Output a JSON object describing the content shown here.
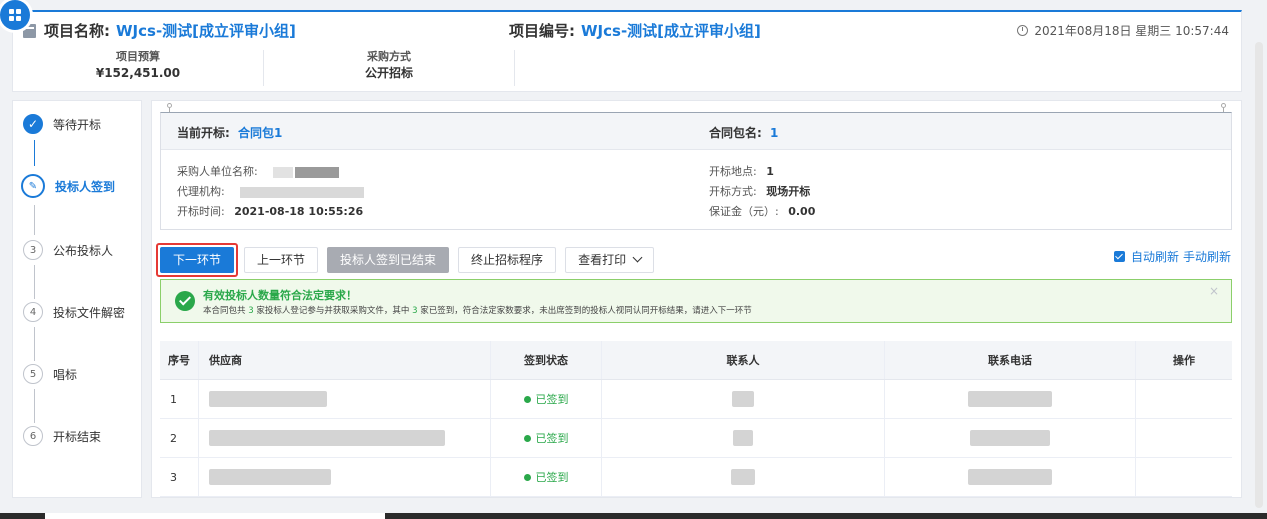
{
  "header": {
    "project_name_label": "项目名称:",
    "project_name": "WJcs-测试[成立评审小组]",
    "project_no_label": "项目编号:",
    "project_no": "WJcs-测试[成立评审小组]",
    "datetime": "2021年08月18日 星期三 10:57:44",
    "budget_label": "项目预算",
    "budget": "¥152,451.00",
    "method_label": "采购方式",
    "method": "公开招标"
  },
  "steps": [
    {
      "index": "✓",
      "label": "等待开标",
      "state": "done"
    },
    {
      "index": "✎",
      "label": "投标人签到",
      "state": "active"
    },
    {
      "index": "3",
      "label": "公布投标人",
      "state": "pending"
    },
    {
      "index": "4",
      "label": "投标文件解密",
      "state": "pending"
    },
    {
      "index": "5",
      "label": "唱标",
      "state": "pending"
    },
    {
      "index": "6",
      "label": "开标结束",
      "state": "pending"
    }
  ],
  "opening": {
    "current_label": "当前开标:",
    "current_value": "合同包1",
    "package_label": "合同包名:",
    "package_value": "1",
    "purchaser_label": "采购人单位名称:",
    "agency_label": "代理机构:",
    "time_label": "开标时间:",
    "time_value": "2021-08-18 10:55:26",
    "place_label": "开标地点:",
    "place_value": "1",
    "mode_label": "开标方式:",
    "mode_value": "现场开标",
    "deposit_label": "保证金（元）:",
    "deposit_value": "0.00"
  },
  "buttons": {
    "next": "下一环节",
    "prev": "上一环节",
    "signin_ended": "投标人签到已结束",
    "terminate": "终止招标程序",
    "print": "查看打印"
  },
  "refresh": {
    "auto": "自动刷新",
    "manual": "手动刷新"
  },
  "alert": {
    "title": "有效投标人数量符合法定要求！",
    "desc_1": "本合同包共",
    "count_registered": "3",
    "desc_2": "家投标人登记参与并获取采购文件，其中",
    "count_signed": "3",
    "desc_3": "家已签到，符合法定家数要求，未出席签到的投标人视同认同开标结果，请进入下一环节",
    "close": "×"
  },
  "table": {
    "headers": [
      "序号",
      "供应商",
      "签到状态",
      "联系人",
      "联系电话",
      "操作"
    ],
    "rows": [
      {
        "no": "1",
        "status": "已签到"
      },
      {
        "no": "2",
        "status": "已签到"
      },
      {
        "no": "3",
        "status": "已签到"
      }
    ]
  }
}
